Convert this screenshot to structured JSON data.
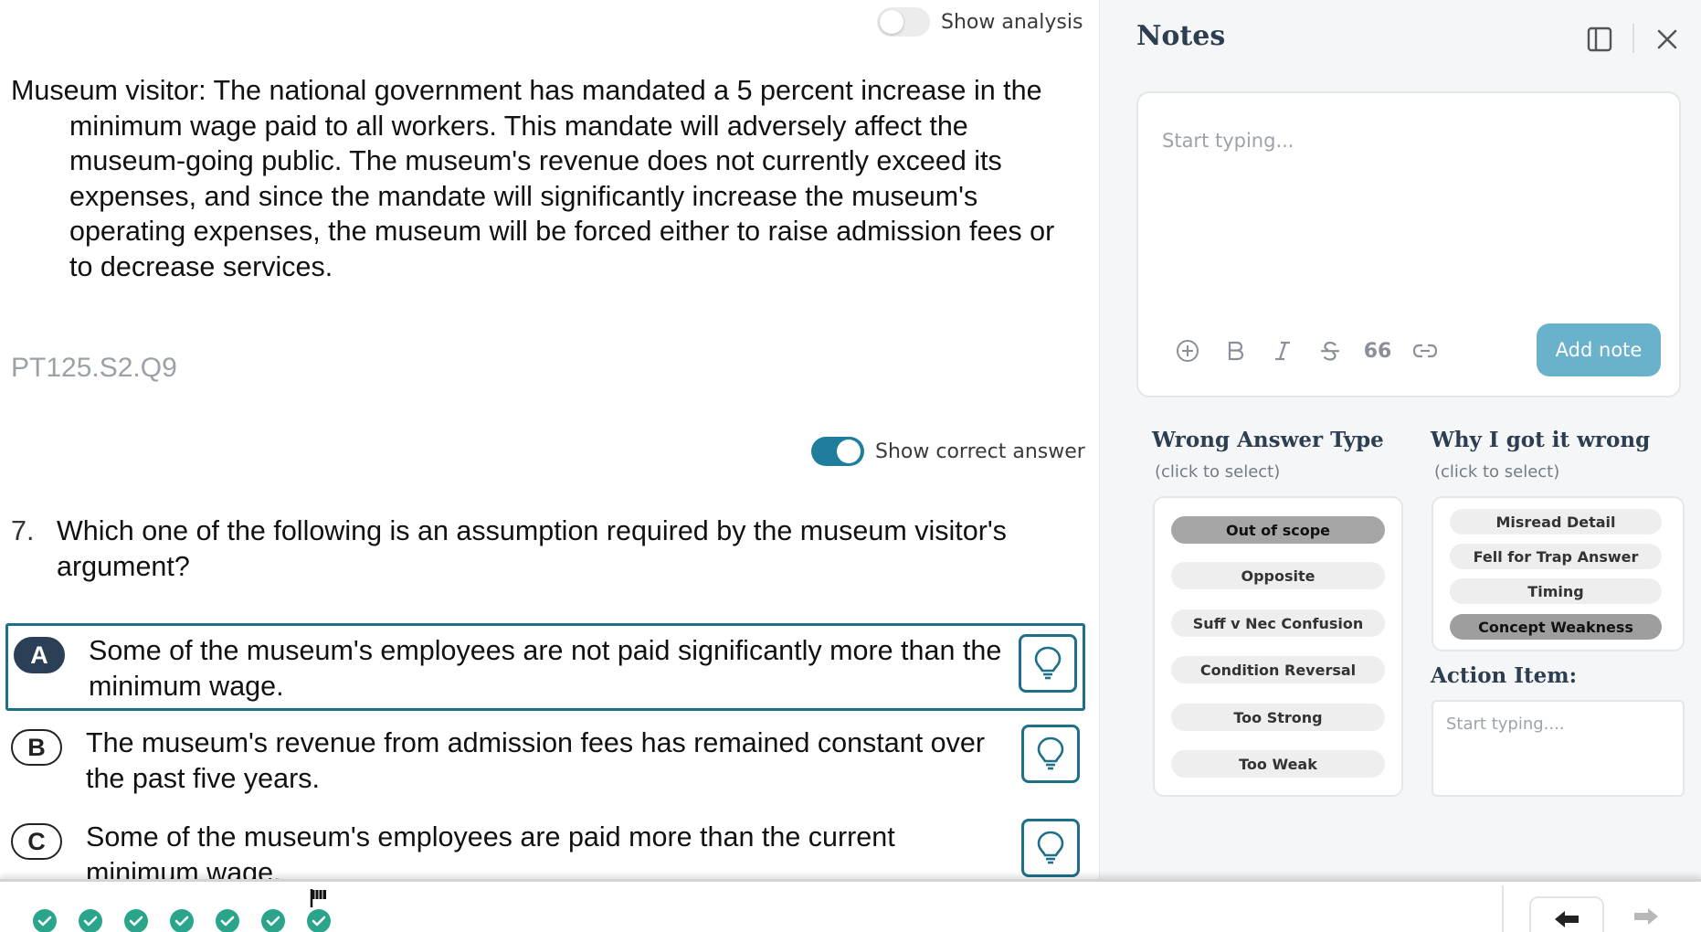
{
  "left": {
    "show_analysis_label": "Show analysis",
    "show_analysis_on": false,
    "stimulus": "Museum visitor: The national government has mandated a 5 percent increase in the minimum wage paid to all workers. This mandate will adversely affect the museum-going public. The museum's revenue does not currently exceed its expenses, and since the mandate will significantly increase the museum's operating expenses, the museum will be forced either to raise admission fees or to decrease services.",
    "question_id": "PT125.S2.Q9",
    "show_correct_label": "Show correct answer",
    "show_correct_on": true,
    "question_number": "7.",
    "question_text": "Which one of the following is an assumption required by the museum visitor's argument?",
    "choices": [
      {
        "letter": "A",
        "text": "Some of the museum's employees are not paid significantly more than the minimum wage.",
        "selected": true
      },
      {
        "letter": "B",
        "text": "The museum's revenue from admission fees has remained constant over the past five years.",
        "selected": false
      },
      {
        "letter": "C",
        "text": "Some of the museum's employees are paid more than the current minimum wage.",
        "selected": false
      }
    ]
  },
  "notes": {
    "title": "Notes",
    "placeholder": "Start typing...",
    "format_quote": "66",
    "add_note_label": "Add note",
    "wrong_answer_type": {
      "title": "Wrong Answer Type",
      "subtitle": "(click to select)",
      "options": [
        "Out of scope",
        "Opposite",
        "Suff v Nec Confusion",
        "Condition Reversal",
        "Too Strong",
        "Too Weak"
      ],
      "selected": "Out of scope"
    },
    "why_wrong": {
      "title": "Why I got it wrong",
      "subtitle": "(click to select)",
      "options": [
        "Misread Detail",
        "Fell for Trap Answer",
        "Timing",
        "Concept Weakness"
      ],
      "selected": "Concept Weakness"
    },
    "action_item": {
      "title": "Action Item:",
      "placeholder": "Start typing...."
    }
  },
  "colors": {
    "accent": "#1f7d9e",
    "selected_border": "#1f6f8b",
    "add_note_bg": "#6ab1cb",
    "progress_done": "#2aa58c"
  },
  "progress": {
    "completed_count": 7,
    "flagged_index": 7
  }
}
